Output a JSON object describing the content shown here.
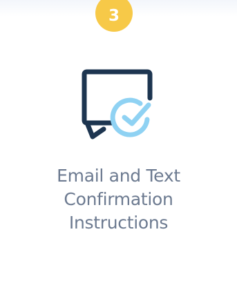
{
  "step": {
    "number": "3"
  },
  "illustration": {
    "bubble_icon": "speech-bubble-icon",
    "check_icon": "check-circle-icon",
    "colors": {
      "bubble": "#1d3550",
      "check": "#8fd2f3"
    }
  },
  "caption": {
    "lines": [
      "Email and Text",
      "Confirmation",
      "Instructions"
    ]
  },
  "colors": {
    "badge": "#f7c948",
    "caption": "#6c7a90",
    "top_band": "#f3f6fb"
  }
}
